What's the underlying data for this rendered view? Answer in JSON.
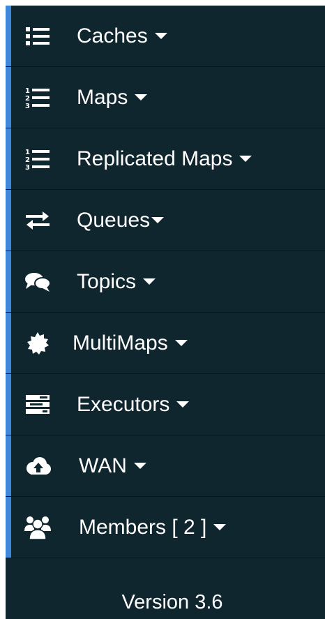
{
  "sidebar": {
    "items": [
      {
        "label": "Caches",
        "icon": "list-icon"
      },
      {
        "label": "Maps",
        "icon": "list-ordered-icon"
      },
      {
        "label": "Replicated Maps",
        "icon": "list-ordered-icon"
      },
      {
        "label": "Queues",
        "icon": "exchange-icon"
      },
      {
        "label": "Topics",
        "icon": "comments-icon"
      },
      {
        "label": "MultiMaps",
        "icon": "certificate-icon"
      },
      {
        "label": "Executors",
        "icon": "tasks-icon"
      },
      {
        "label": "WAN",
        "icon": "cloud-upload-icon"
      },
      {
        "label": "Members [ 2 ]",
        "icon": "users-icon"
      }
    ],
    "accent_color": "#3f87d9",
    "background_color": "#10262f"
  },
  "footer": {
    "version": "Version 3.6"
  }
}
